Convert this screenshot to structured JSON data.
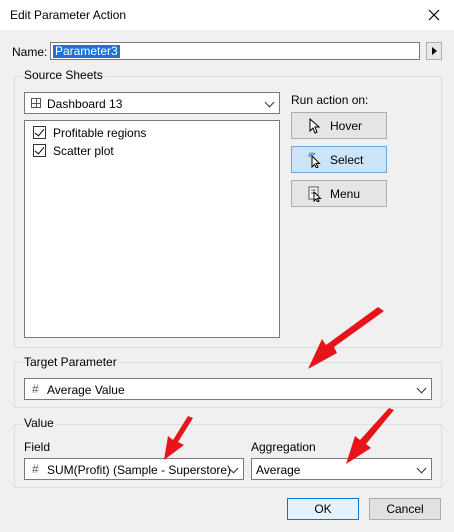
{
  "window": {
    "title": "Edit Parameter Action"
  },
  "name": {
    "label": "Name:",
    "value": "Parameter3"
  },
  "source_sheets": {
    "label": "Source Sheets",
    "dashboard": "Dashboard 13",
    "sheets": [
      {
        "label": "Profitable regions",
        "checked": true
      },
      {
        "label": "Scatter plot",
        "checked": true
      }
    ]
  },
  "run_action": {
    "label": "Run action on:",
    "options": [
      {
        "label": "Hover",
        "selected": false,
        "icon": "pointer-icon"
      },
      {
        "label": "Select",
        "selected": true,
        "icon": "select-click-icon"
      },
      {
        "label": "Menu",
        "selected": false,
        "icon": "menu-icon"
      }
    ]
  },
  "target_parameter": {
    "label": "Target Parameter",
    "value": "Average Value"
  },
  "value": {
    "label": "Value",
    "field_label": "Field",
    "field_value": "SUM(Profit) (Sample - Superstore)",
    "aggregation_label": "Aggregation",
    "aggregation_value": "Average"
  },
  "buttons": {
    "ok": "OK",
    "cancel": "Cancel"
  },
  "colors": {
    "selection": "#1a73d9",
    "selected_button": "#cce4f7",
    "annotation_arrow": "#e8141b"
  }
}
